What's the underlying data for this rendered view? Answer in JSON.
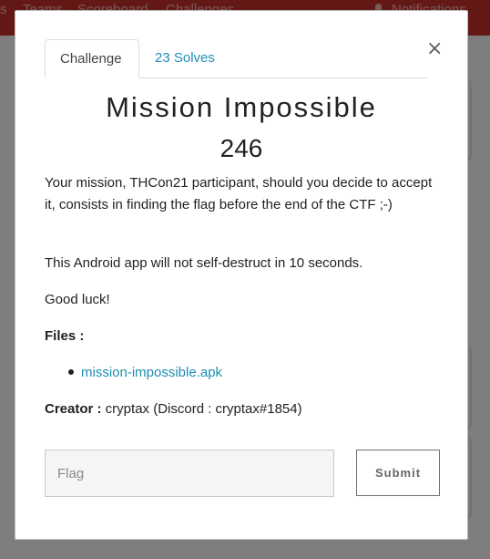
{
  "navbar": {
    "links": [
      "s",
      "Teams",
      "Scoreboard",
      "Challenges"
    ],
    "notifications_label": "Notifications",
    "bell_icon": "bell-icon"
  },
  "modal": {
    "close_symbol": "×",
    "tabs": [
      {
        "label": "Challenge",
        "active": true
      },
      {
        "label": "23 Solves",
        "active": false
      }
    ],
    "title": "Mission Impossible",
    "points": "246",
    "description": [
      "Your mission, THCon21 participant, should you decide to accept it, consists in finding the flag before the end of the CTF ;-)",
      "This Android app will not self-destruct in 10 seconds.",
      "Good luck!"
    ],
    "files_label": "Files :",
    "files": [
      "mission-impossible.apk"
    ],
    "creator_label": "Creator :",
    "creator_value": " cryptax (Discord : cryptax#1854)",
    "flag_placeholder": "Flag",
    "submit_label": "Submit"
  },
  "colors": {
    "navbar": "#c9302c",
    "link": "#1e8fb3",
    "overlay": "rgba(0,0,0,0.5)"
  }
}
